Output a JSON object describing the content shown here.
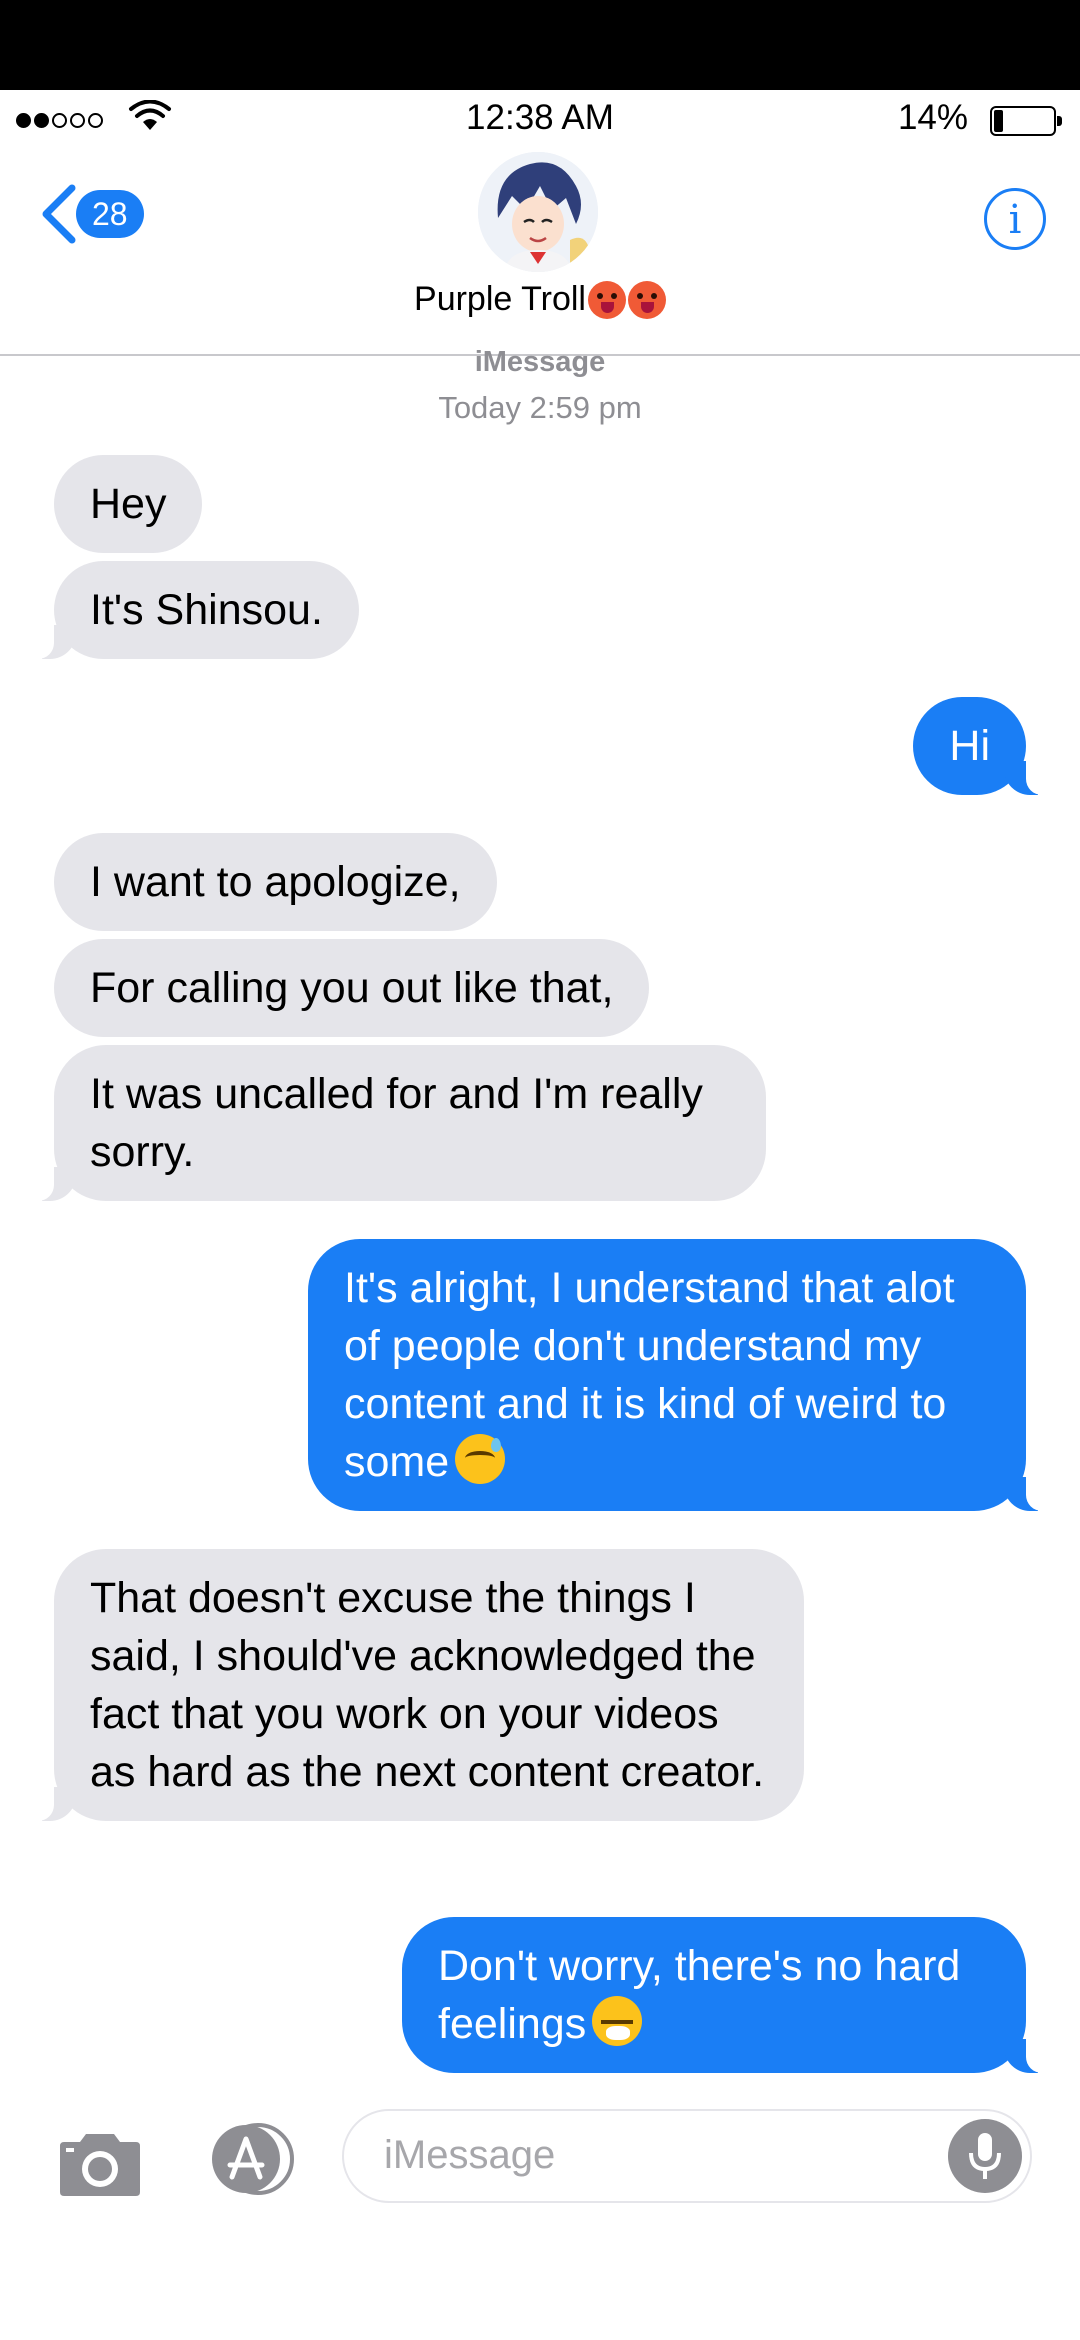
{
  "status_bar": {
    "time": "12:38 AM",
    "battery_percent": "14%",
    "signal_bars_filled": 2,
    "signal_bars_total": 5
  },
  "header": {
    "back_badge_count": "28",
    "contact_name": "Purple Troll",
    "contact_name_emoji_icons": [
      "angry-face-icon",
      "angry-face-icon"
    ],
    "info_icon_glyph": "i"
  },
  "conversation": {
    "service_label": "iMessage",
    "timestamp": "Today 2:59 pm"
  },
  "messages": [
    {
      "direction": "incoming",
      "text": "Hey"
    },
    {
      "direction": "incoming",
      "text": "It's Shinsou."
    },
    {
      "direction": "outgoing",
      "text": "Hi"
    },
    {
      "direction": "incoming",
      "text": "I want to apologize,"
    },
    {
      "direction": "incoming",
      "text": "For calling you out like that,"
    },
    {
      "direction": "incoming",
      "text": "It was uncalled for and I'm really sorry."
    },
    {
      "direction": "outgoing",
      "text": "It's alright, I understand that alot of people don't understand my content and it is kind of weird to some",
      "emoji": "grinning-sweat-icon"
    },
    {
      "direction": "incoming",
      "text": "That doesn't excuse the things I said, I should've acknowledged the fact that you work on your videos as hard as the next content creator."
    },
    {
      "direction": "outgoing",
      "text": "Don't worry, there's no hard feelings",
      "emoji": "sneezing-face-icon"
    }
  ],
  "input_bar": {
    "placeholder": "iMessage"
  },
  "colors": {
    "accent_blue": "#1a7ef5",
    "incoming_bubble": "#e5e5ea",
    "secondary_text": "#8e8e93"
  }
}
